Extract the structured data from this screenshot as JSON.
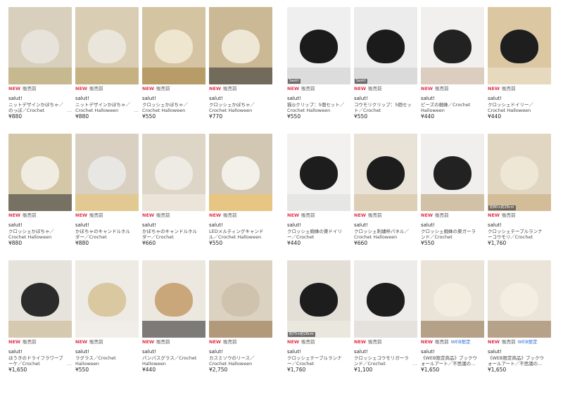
{
  "labels": {
    "new": "NEW",
    "status": "販売前",
    "web_only": "WEB限定",
    "more": "…"
  },
  "left": [
    {
      "brand": "salut!",
      "name": "ニットデザインかぼちゃ／のっぽ／Crochet",
      "price": "¥880",
      "more": true,
      "bg": "#d8cfbd",
      "obj": "#e8e3da",
      "accent": "#b8a66a"
    },
    {
      "brand": "salut!",
      "name": "ニットデザインかぼちゃ／Crochet Halloween",
      "price": "¥880",
      "more": true,
      "bg": "#d9cdb4",
      "obj": "#ebe6dc",
      "accent": "#b49a5a"
    },
    {
      "brand": "salut!",
      "name": "クロッシェかぼちゃ／Crochet Halloween",
      "price": "¥550",
      "bg": "#d5c4a1",
      "obj": "#efe6cf",
      "accent": "#9e7b3a"
    },
    {
      "brand": "salut!",
      "name": "クロッシェかぼちゃ／Crochet Halloween",
      "price": "¥770",
      "bg": "#cbb894",
      "obj": "#efe7d6",
      "accent": "#2a2a2a"
    },
    {
      "brand": "salut!",
      "name": "クロッシェかぼちゃ／Crochet Halloween",
      "price": "¥880",
      "bg": "#d4c7a8",
      "obj": "#f1ece1",
      "accent": "#2a2a2a"
    },
    {
      "brand": "salut!",
      "name": "かぼちゃのキャンドルホルダー／Crochet",
      "price": "¥880",
      "bg": "#d9d0c2",
      "obj": "#e9e7e4",
      "accent": "#e8c26a"
    },
    {
      "brand": "salut!",
      "name": "かぼちゃのキャンドルホルダー／Crochet",
      "price": "¥660",
      "bg": "#ddd5c6",
      "obj": "#eeeae4",
      "accent": "#f4f1ea"
    },
    {
      "brand": "salut!",
      "name": "LEDメルティングキャンドル／Crochet Halloween",
      "price": "¥550",
      "bg": "#d2c7b3",
      "obj": "#f3f0ea",
      "accent": "#f5c45a"
    },
    {
      "brand": "salut!",
      "name": "ほうきのドライフラワーブーケ／Crochet",
      "price": "¥1,650",
      "more": true,
      "bg": "#e6e2dc",
      "obj": "#2b2b2b",
      "accent": "#c7b58a"
    },
    {
      "brand": "salut!",
      "name": "ラグラス／Crochet Halloween",
      "price": "¥550",
      "bg": "#eeeae4",
      "obj": "#d9c8a0",
      "accent": "#f4f1ec"
    },
    {
      "brand": "salut!",
      "name": "パンパスグラス／Crochet Halloween",
      "price": "¥440",
      "bg": "#ece7df",
      "obj": "#caa77a",
      "accent": "#222"
    },
    {
      "brand": "salut!",
      "name": "カスミソウのリース／Crochet Halloween",
      "price": "¥2,750",
      "bg": "#dcd2c2",
      "obj": "#cfc3ad",
      "accent": "#8e6a3f"
    }
  ],
  "right": [
    {
      "brand": "salut!",
      "name": "猫◎クリップ：5個セット／Crochet Halloween",
      "price": "¥550",
      "badge": "Sasiri",
      "bg": "#efefef",
      "obj": "#1b1b1b",
      "accent": "#cccccc"
    },
    {
      "brand": "salut!",
      "name": "コウモリクリップ：5個セット／Crochet",
      "price": "¥550",
      "badge": "Sasiri",
      "bg": "#ececec",
      "obj": "#1b1b1b",
      "accent": "#cccccc"
    },
    {
      "brand": "salut!",
      "name": "ビーズの蜘蛛／Crochet Halloween",
      "price": "¥440",
      "bg": "#f1f0ee",
      "obj": "#222",
      "accent": "#c8b39a"
    },
    {
      "brand": "salut!",
      "name": "クロッシェドイリー／Crochet Halloween",
      "price": "¥440",
      "bg": "#dcc7a3",
      "obj": "#1e1e1e",
      "accent": "#efe7d6"
    },
    {
      "brand": "salut!",
      "name": "クロッシェ蜘蛛の巣ドイリー／Crochet",
      "price": "¥440",
      "bg": "#f2f1ef",
      "obj": "#1d1d1d",
      "accent": "#ddd"
    },
    {
      "brand": "salut!",
      "name": "クロッシェ刺繍枠パネル／Crochet Halloween",
      "price": "¥660",
      "bg": "#e9e2d6",
      "obj": "#1d1d1d",
      "accent": "#d2c09a"
    },
    {
      "brand": "salut!",
      "name": "クロッシェ蜘蛛の巣ガーランド／Crochet",
      "price": "¥550",
      "bg": "#f0efed",
      "obj": "#222",
      "accent": "#b89a6b"
    },
    {
      "brand": "salut!",
      "name": "クロッシェテーブルランナーコウモリ／Crochet",
      "price": "¥1,760",
      "badge": "約80×約28cm",
      "bg": "#e0d6c2",
      "obj": "#efe7d6",
      "accent": "#c9a978"
    },
    {
      "brand": "salut!",
      "name": "クロッシェテーブルランナー／Crochet",
      "price": "¥1,760",
      "badge": "約75×約28cm",
      "bg": "#e3ded6",
      "obj": "#1d1d1d",
      "accent": "#f1eee8"
    },
    {
      "brand": "salut!",
      "name": "クロッシェコウモリガーランド／Crochet",
      "price": "¥1,100",
      "more": true,
      "bg": "#edecea",
      "obj": "#1d1d1d",
      "accent": "#dedad4"
    },
    {
      "brand": "salut!",
      "name": "《WEB限定商品》ブックウォールアート／不思議の…",
      "price": "¥1,650",
      "web": true,
      "bg": "#e9e3d8",
      "obj": "#f3ede0",
      "accent": "#8a6b45"
    },
    {
      "brand": "salut!",
      "name": "《WEB限定商品》ブックウォールアート／不思議の…",
      "price": "¥1,650",
      "web": true,
      "bg": "#ebe5d9",
      "obj": "#f4eee2",
      "accent": "#8a6b45"
    }
  ]
}
